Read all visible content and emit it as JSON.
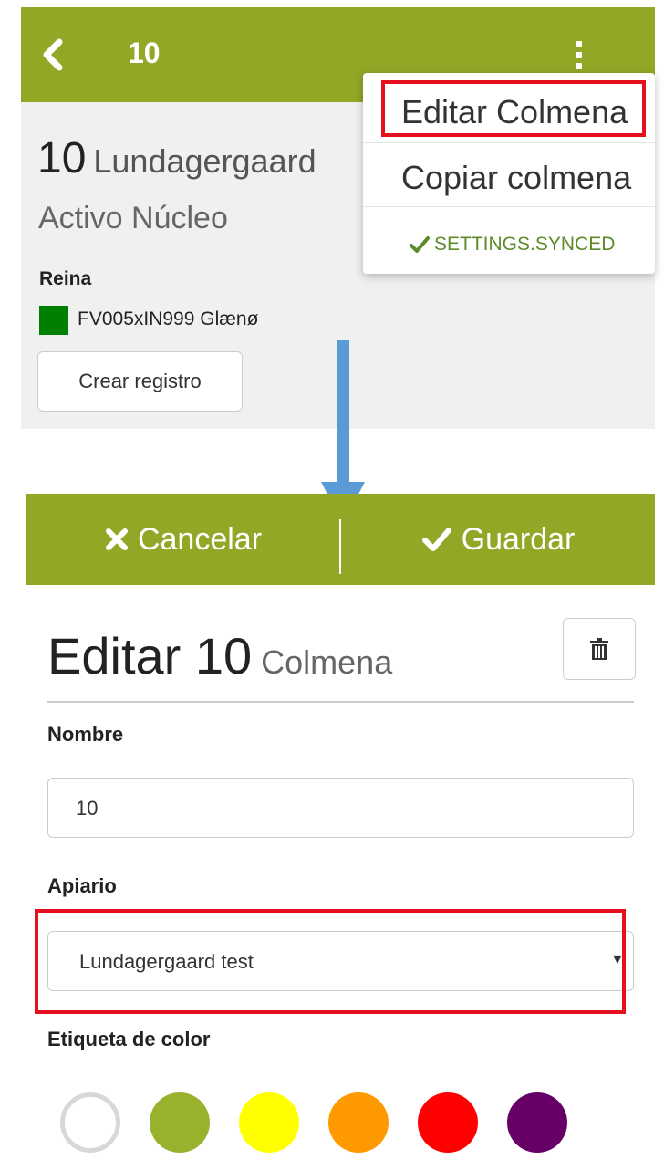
{
  "top_screen": {
    "topbar": {
      "title": "10",
      "back_icon": "chevron-left-icon",
      "menu_icon": "kebab-vertical-icon"
    },
    "hive": {
      "number": "10",
      "apiary": "Lundagergaard",
      "status": "Activo Núcleo",
      "queen_label": "Reina",
      "queen_color": "#008000",
      "queen_name": "FV005xIN999 Glænø",
      "create_record_label": "Crear registro"
    },
    "menu": {
      "edit_label": "Editar Colmena",
      "copy_label": "Copiar colmena",
      "sync_status": "SETTINGS.SYNCED",
      "sync_icon": "check-icon"
    }
  },
  "edit_screen": {
    "cancel_label": "Cancelar",
    "save_label": "Guardar",
    "title_prefix": "Editar",
    "title_number": "10",
    "title_subject": "Colmena",
    "delete_icon": "trash-icon",
    "name_label": "Nombre",
    "name_value": "10",
    "apiary_label": "Apiario",
    "apiary_value": "Lundagergaard test",
    "color_label": "Etiqueta de color",
    "color_options": [
      "#ffffff",
      "#98b22e",
      "#ffff00",
      "#ff9900",
      "#ff0000",
      "#660066"
    ]
  },
  "colors": {
    "brand_green": "#93a727",
    "highlight_red": "#e4101e",
    "arrow_blue": "#5b9bd5",
    "sync_green": "#5d8b2a"
  }
}
